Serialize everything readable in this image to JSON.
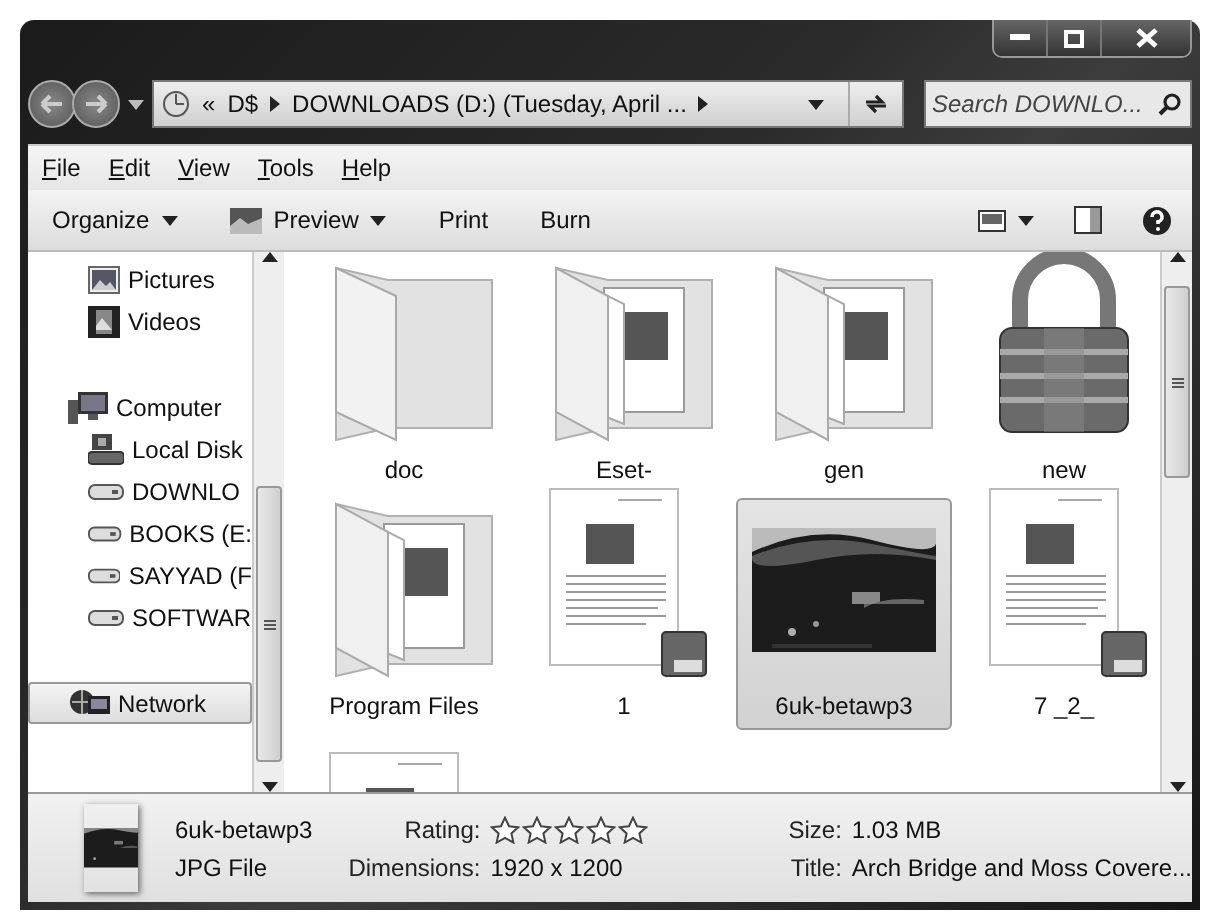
{
  "address": {
    "overflow": "«",
    "crumbs": [
      {
        "label": "D$"
      },
      {
        "label": "DOWNLOADS (D:) (Tuesday, April ..."
      }
    ]
  },
  "search": {
    "placeholder": "Search DOWNLO..."
  },
  "menu": [
    "File",
    "Edit",
    "View",
    "Tools",
    "Help"
  ],
  "toolbar": [
    {
      "label": "Organize",
      "kind": "dropdown"
    },
    {
      "label": "Preview",
      "kind": "preview"
    },
    {
      "label": "Print",
      "kind": "plain"
    },
    {
      "label": "Burn",
      "kind": "plain"
    }
  ],
  "sidebar": {
    "library_items": [
      {
        "label": "Pictures",
        "kind": "pictures",
        "selected": false
      },
      {
        "label": "Videos",
        "kind": "videos",
        "selected": false
      }
    ],
    "items": [
      {
        "label": "Computer",
        "kind": "computer",
        "selected": false,
        "children": [
          {
            "label": "Local Disk",
            "kind": "system-disk",
            "selected": false
          },
          {
            "label": "DOWNLO",
            "kind": "drive",
            "selected": false
          },
          {
            "label": "BOOKS (E:",
            "kind": "drive",
            "selected": false
          },
          {
            "label": "SAYYAD (F",
            "kind": "drive",
            "selected": false
          },
          {
            "label": "SOFTWAR",
            "kind": "drive",
            "selected": false
          }
        ]
      },
      {
        "label": "Network",
        "kind": "network",
        "selected": true
      }
    ]
  },
  "files": [
    {
      "name": "doc",
      "kind": "folder",
      "selected": false
    },
    {
      "name": "Eset-",
      "kind": "folder-files",
      "selected": false
    },
    {
      "name": "gen",
      "kind": "folder-files",
      "selected": false
    },
    {
      "name": "new",
      "kind": "padlock",
      "selected": false
    },
    {
      "name": "Program Files",
      "kind": "folder-files",
      "selected": false
    },
    {
      "name": "1",
      "kind": "pdf",
      "selected": false
    },
    {
      "name": "6uk-betawp3",
      "selected": true
    },
    {
      "name": "7 _2_",
      "kind": "pdf",
      "selected": false
    },
    {
      "kind": "pdf",
      "selected": false
    }
  ],
  "details": {
    "name": "6uk-betawp3",
    "type": "JPG File",
    "rating_label": "Rating:",
    "stars": 0,
    "dimensions_label": "Dimensions:",
    "dimensions": "1920 x 1200",
    "size_label": "Size:",
    "size": "1.03 MB",
    "title_label": "Title:",
    "title": "Arch Bridge and Moss Covere..."
  }
}
